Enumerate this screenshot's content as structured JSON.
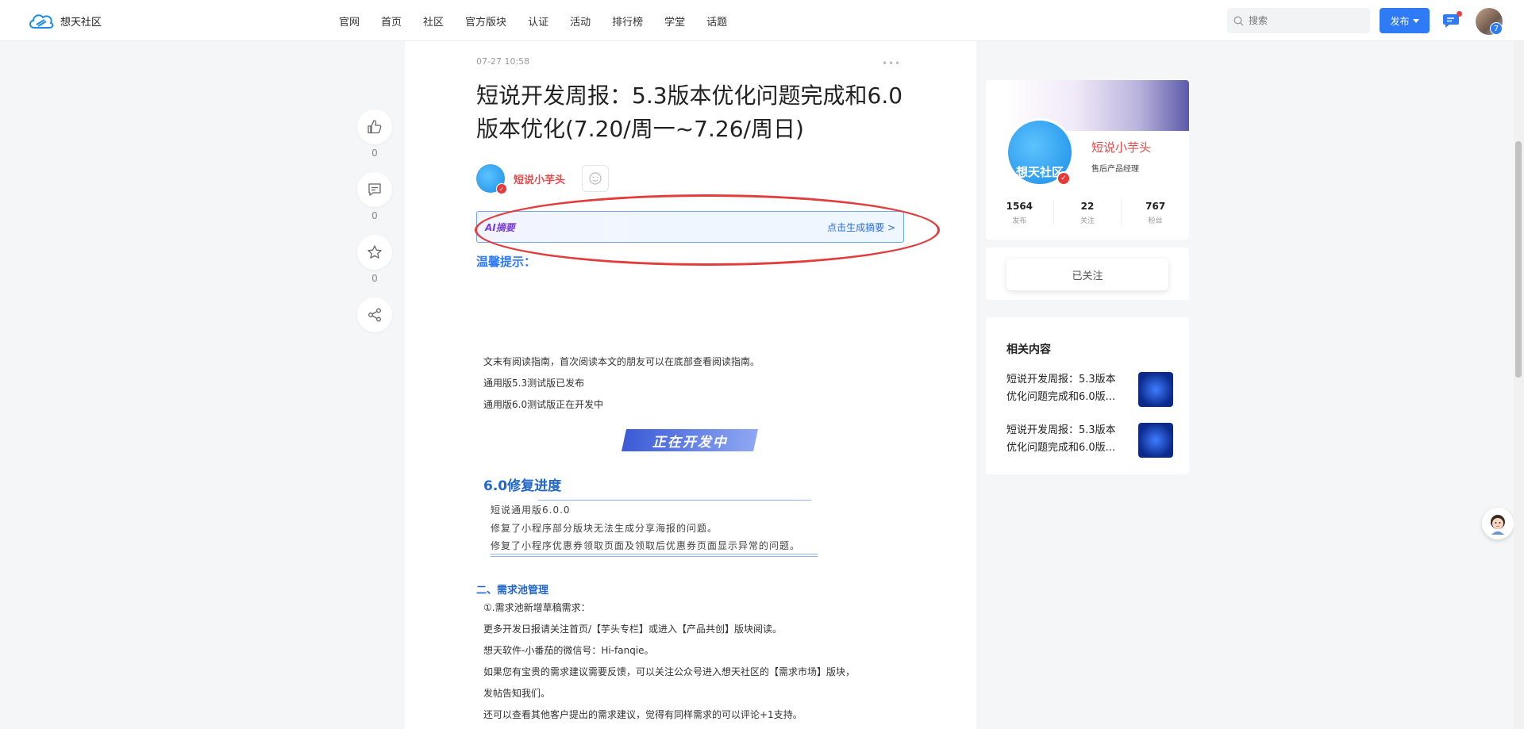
{
  "header": {
    "logo_text": "想天社区",
    "nav": [
      "官网",
      "首页",
      "社区",
      "官方版块",
      "认证",
      "活动",
      "排行榜",
      "学堂",
      "话题"
    ],
    "search_placeholder": "搜索",
    "publish_label": "发布",
    "user_badge": "7"
  },
  "article": {
    "time": "07-27 10:58",
    "more": "•••",
    "title": "短说开发周报：5.3版本优化问题完成和6.0版本优化(7.20/周一~7.26/周日)",
    "author": "短说小芋头",
    "ai_label": "AI摘要",
    "ai_link": "点击生成摘要 >",
    "tip_heading": "温馨提示：",
    "intro_lines": [
      "文末有阅读指南，首次阅读本文的朋友可以在底部查看阅读指南。",
      "通用版5.3测试版已发布",
      "通用版6.0测试版正在开发中"
    ],
    "dev_banner": "正在开发中",
    "fix_heading": "6.0修复进度",
    "fix_lines": [
      "短说通用版6.0.0",
      "修复了小程序部分版块无法生成分享海报的问题。",
      "修复了小程序优惠券领取页面及领取后优惠券页面显示异常的问题。"
    ],
    "req_heading": "二、需求池管理",
    "req_lines": [
      "①.需求池新增草稿需求：",
      "更多开发日报请关注首页/【芋头专栏】或进入【产品共创】版块阅读。",
      "想天软件-小番茄的微信号：Hi-fanqie。",
      "如果您有宝贵的需求建议需要反馈，可以关注公众号进入想天社区的【需求市场】版块，",
      "发帖告知我们。",
      "还可以查看其他客户提出的需求建议，觉得有同样需求的可以评论+1支持。"
    ]
  },
  "actions": {
    "like_count": "0",
    "comment_count": "0",
    "favorite_count": "0"
  },
  "profile": {
    "avatar_text": "想天社区",
    "name": "短说小芋头",
    "role": "售后产品经理",
    "stats": [
      {
        "num": "1564",
        "label": "发布"
      },
      {
        "num": "22",
        "label": "关注"
      },
      {
        "num": "767",
        "label": "粉丝"
      }
    ],
    "follow_label": "已关注"
  },
  "related": {
    "title": "相关内容",
    "items": [
      {
        "line1": "短说开发周报：5.3版本",
        "line2": "优化问题完成和6.0版..."
      },
      {
        "line1": "短说开发周报：5.3版本",
        "line2": "优化问题完成和6.0版..."
      }
    ]
  },
  "colors": {
    "accent": "#2f7bf5",
    "author_red": "#e24b4b",
    "annotation_red": "#e23c3c"
  }
}
